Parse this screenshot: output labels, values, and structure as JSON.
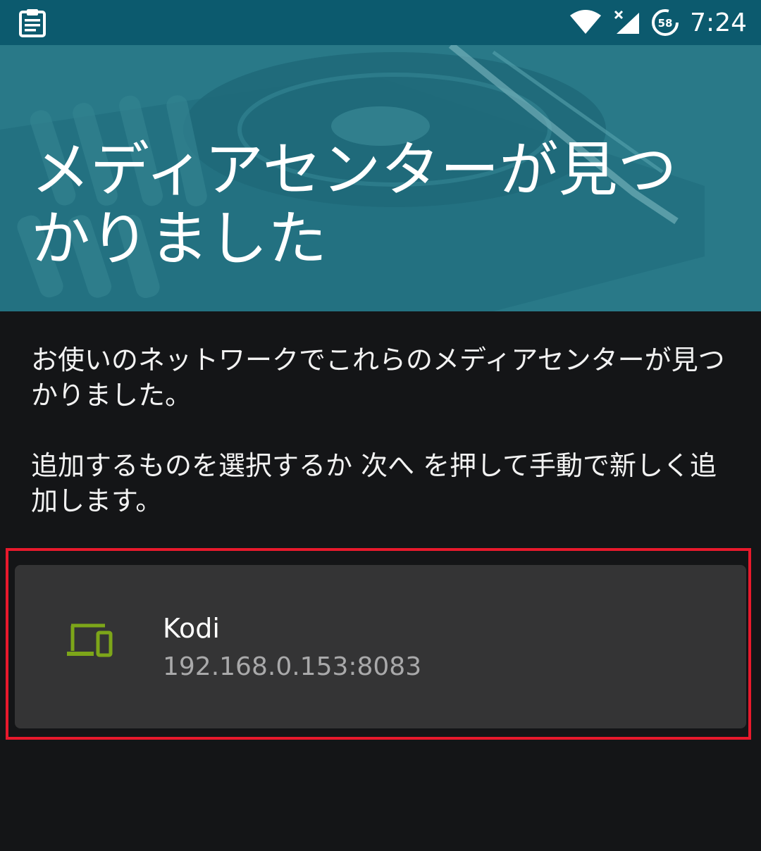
{
  "status_bar": {
    "time": "7:24",
    "battery_level": "58",
    "icons": [
      "clipboard-icon",
      "wifi-icon",
      "cellular-no-signal-icon",
      "battery-saver-icon"
    ]
  },
  "header": {
    "title": "メディアセンターが見つかりました"
  },
  "body": {
    "description_1": "お使いのネットワークでこれらのメディアセンターが見つかりました。",
    "description_2": "追加するものを選択するか 次へ を押して手動で新しく追加します。"
  },
  "servers": [
    {
      "name": "Kodi",
      "address": "192.168.0.153:8083",
      "icon": "devices-icon"
    }
  ],
  "colors": {
    "status_bar": "#0c5a6e",
    "header_tint": "#2c7b8a",
    "background": "#141517",
    "card": "#343435",
    "accent_icon": "#7da619",
    "highlight": "#e8192c"
  }
}
